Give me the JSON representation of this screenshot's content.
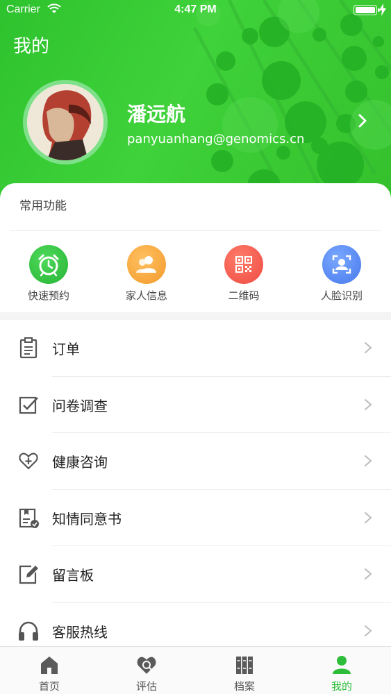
{
  "status_bar": {
    "carrier": "Carrier",
    "time": "4:47 PM"
  },
  "header": {
    "title": "我的",
    "user_name": "潘远航",
    "user_email": "panyuanhang@genomics.cn"
  },
  "common": {
    "title": "常用功能",
    "items": [
      {
        "label": "快速预约",
        "icon": "alarm-clock-icon",
        "color": "#2fbf3d"
      },
      {
        "label": "家人信息",
        "icon": "family-icon",
        "color": "#f5a53b"
      },
      {
        "label": "二维码",
        "icon": "qr-code-icon",
        "color": "#f2554a"
      },
      {
        "label": "人脸识别",
        "icon": "face-recognition-icon",
        "color": "#4f86f0"
      }
    ]
  },
  "menu": {
    "items": [
      {
        "label": "订单",
        "icon": "clipboard-icon"
      },
      {
        "label": "问卷调查",
        "icon": "checkbox-icon"
      },
      {
        "label": "健康咨询",
        "icon": "heart-plus-icon"
      },
      {
        "label": "知情同意书",
        "icon": "consent-form-icon"
      },
      {
        "label": "留言板",
        "icon": "edit-note-icon"
      },
      {
        "label": "客服热线",
        "icon": "headphones-icon"
      }
    ]
  },
  "tabbar": {
    "items": [
      {
        "label": "首页",
        "icon": "home-icon",
        "active": false
      },
      {
        "label": "评估",
        "icon": "heart-assess-icon",
        "active": false
      },
      {
        "label": "档案",
        "icon": "archive-icon",
        "active": false
      },
      {
        "label": "我的",
        "icon": "user-icon",
        "active": true
      }
    ],
    "active_color": "#2ebd3a"
  }
}
